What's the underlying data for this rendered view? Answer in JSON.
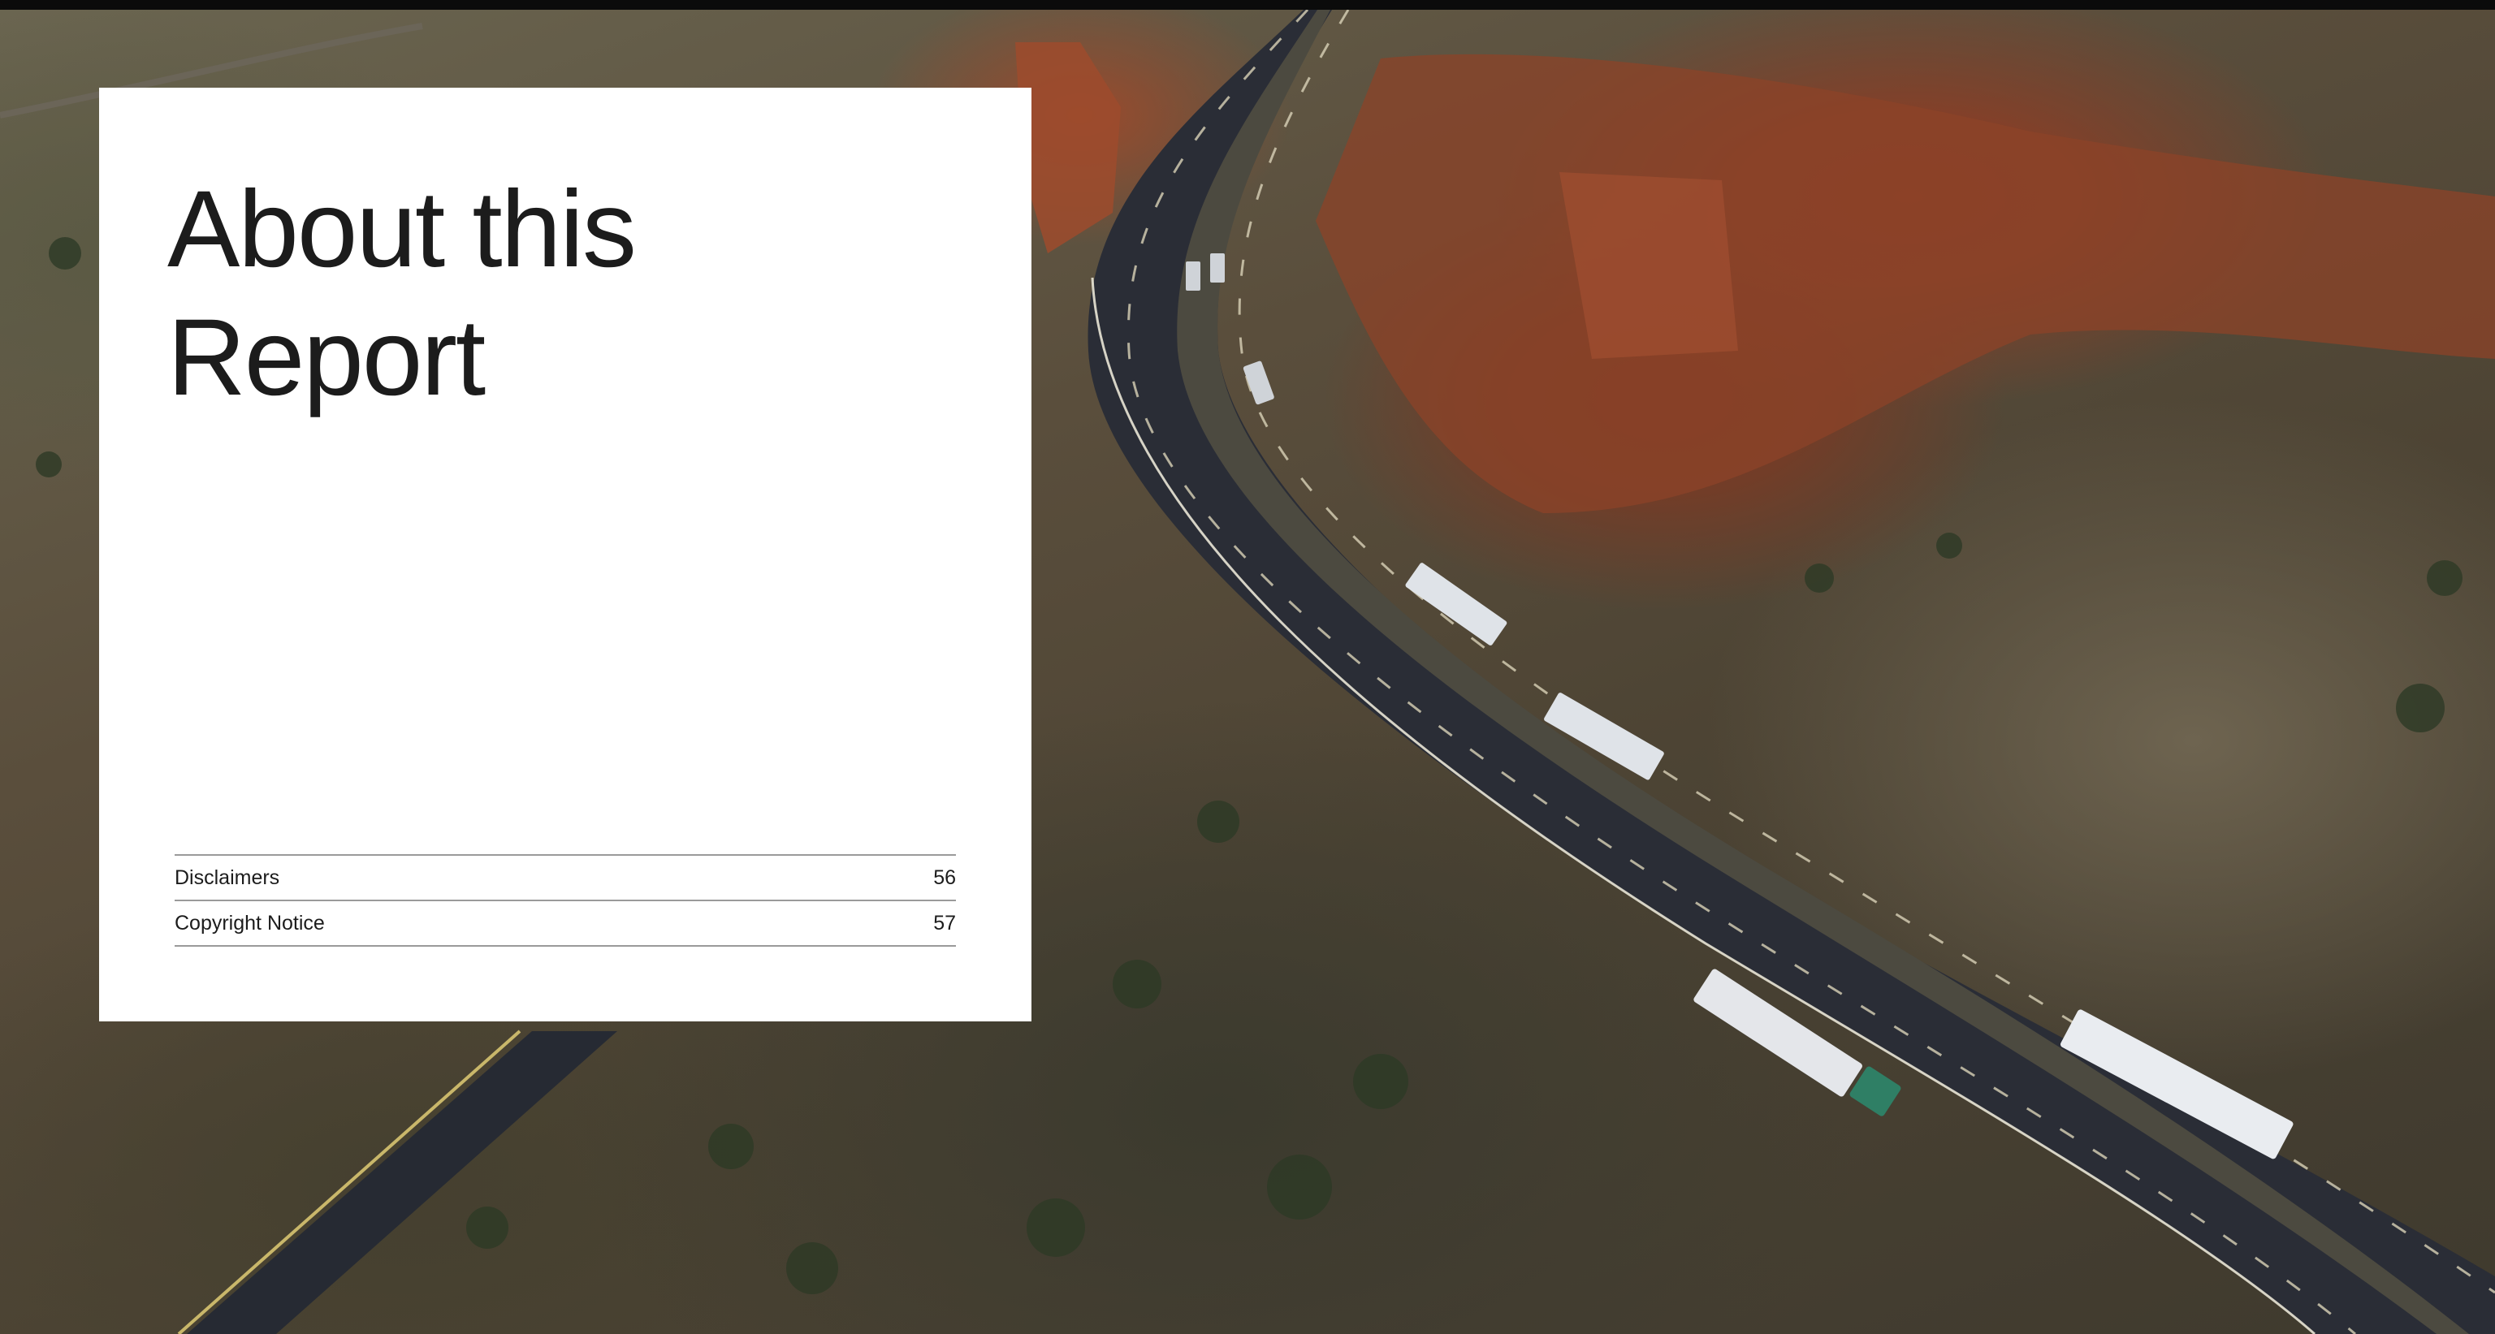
{
  "title": {
    "line1": "About this",
    "line2": "Report"
  },
  "toc": [
    {
      "label": "Disclaimers",
      "page": "56"
    },
    {
      "label": "Copyright Notice",
      "page": "57"
    }
  ],
  "colors": {
    "card_background": "#ffffff",
    "text": "#1c1c1c",
    "rule": "#9a9a9a"
  }
}
